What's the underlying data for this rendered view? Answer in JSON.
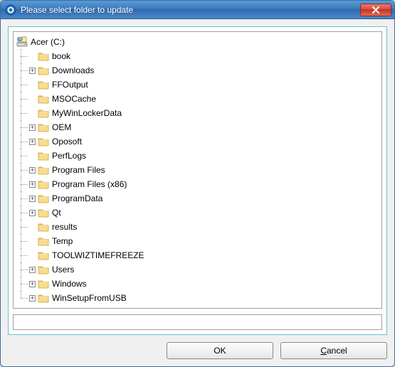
{
  "window": {
    "title": "Please select folder to update"
  },
  "tree": {
    "root": {
      "label": "Acer (C:)",
      "icon": "drive"
    },
    "items": [
      {
        "label": "book",
        "expandable": false
      },
      {
        "label": "Downloads",
        "expandable": true
      },
      {
        "label": "FFOutput",
        "expandable": false
      },
      {
        "label": "MSOCache",
        "expandable": false
      },
      {
        "label": "MyWinLockerData",
        "expandable": false
      },
      {
        "label": "OEM",
        "expandable": true
      },
      {
        "label": "Oposoft",
        "expandable": true
      },
      {
        "label": "PerfLogs",
        "expandable": false
      },
      {
        "label": "Program Files",
        "expandable": true
      },
      {
        "label": "Program Files (x86)",
        "expandable": true
      },
      {
        "label": "ProgramData",
        "expandable": true
      },
      {
        "label": "Qt",
        "expandable": true
      },
      {
        "label": "results",
        "expandable": false
      },
      {
        "label": "Temp",
        "expandable": false
      },
      {
        "label": "TOOLWIZTIMEFREEZE",
        "expandable": false
      },
      {
        "label": "Users",
        "expandable": true
      },
      {
        "label": "Windows",
        "expandable": true
      },
      {
        "label": "WinSetupFromUSB",
        "expandable": true
      }
    ]
  },
  "path": {
    "value": ""
  },
  "buttons": {
    "ok": "OK",
    "cancel_pre": "",
    "cancel_ul": "C",
    "cancel_post": "ancel"
  }
}
